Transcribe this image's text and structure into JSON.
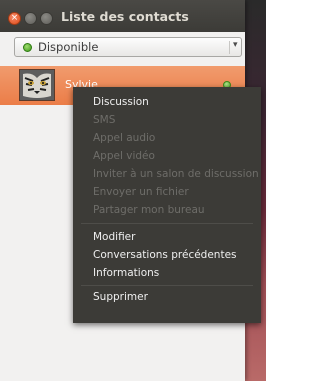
{
  "window": {
    "title": "Liste des contacts",
    "buttons": {
      "close": "×",
      "minimize": "–",
      "maximize": "□"
    }
  },
  "status": {
    "label": "Disponible",
    "arrow": "▾",
    "color": "#4aa526"
  },
  "contact": {
    "name": "Sylvie",
    "avatar": "tiger-avatar",
    "presence_color": "#4aa526"
  },
  "context_menu": {
    "discussion": "Discussion",
    "sms": "SMS",
    "audio_call": "Appel audio",
    "video_call": "Appel vidéo",
    "invite_room": "Inviter à un salon de discussion",
    "send_file": "Envoyer un fichier",
    "share_desktop": "Partager mon bureau",
    "edit": "Modifier",
    "previous_conversations": "Conversations précédentes",
    "information": "Informations",
    "delete": "Supprimer"
  },
  "colors": {
    "accent": "#eb7d48",
    "titlebar": "#3c3b37",
    "menu_bg": "#3c3b37"
  }
}
